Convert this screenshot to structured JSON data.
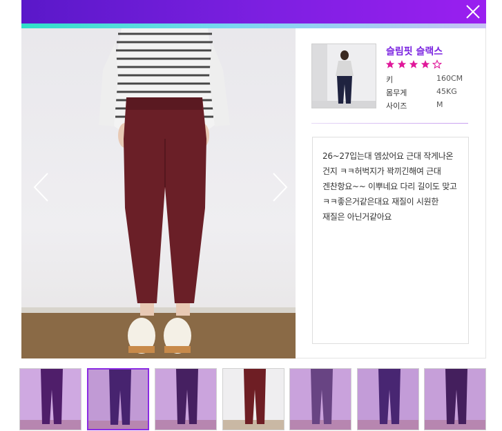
{
  "colors": {
    "header_gradient": [
      "#5a18c9",
      "#9a1ff0"
    ],
    "accent_gradient": [
      "#2fe0c8",
      "#c8c2f4"
    ],
    "product_name": "#7a23e0",
    "stars": "#e0189a",
    "thumb_overlay": "#9628c8"
  },
  "header": {
    "close_icon": "close-icon"
  },
  "viewer": {
    "prev_icon": "chevron-left-icon",
    "next_icon": "chevron-right-icon"
  },
  "product": {
    "name": "슬림핏 슬랙스",
    "rating": 4,
    "rating_max": 5,
    "specs": [
      {
        "label": "키",
        "value": "160CM"
      },
      {
        "label": "몸무게",
        "value": "45KG"
      },
      {
        "label": "사이즈",
        "value": "M"
      }
    ]
  },
  "review": {
    "text": "26~27입는대 엠샀어요 근대 작게나온\n건지 ㅋㅋ허벅지가 꽉끼긴해여 근대\n겐찬항요~~ 이뿌네요 다리 길이도 맞고\nㅋㅋ좋은거같은대요 재질이 시원한\n재질은 아닌거같아요"
  },
  "thumbnails": [
    {
      "pants": "#2a1a38",
      "bg": "#eeeeee",
      "active": false,
      "overlay": true
    },
    {
      "pants": "#1e2140",
      "bg": "#d9d8dc",
      "active": true,
      "overlay": true
    },
    {
      "pants": "#1d1d2a",
      "bg": "#e8e6e8",
      "active": false,
      "overlay": true
    },
    {
      "pants": "#6e1e24",
      "bg": "#efeef0",
      "active": false,
      "overlay": false
    },
    {
      "pants": "#50535e",
      "bg": "#e5e4e6",
      "active": false,
      "overlay": true
    },
    {
      "pants": "#1f2544",
      "bg": "#dcdbe0",
      "active": false,
      "overlay": true
    },
    {
      "pants": "#1a1b24",
      "bg": "#e0dfe2",
      "active": false,
      "overlay": true
    }
  ]
}
